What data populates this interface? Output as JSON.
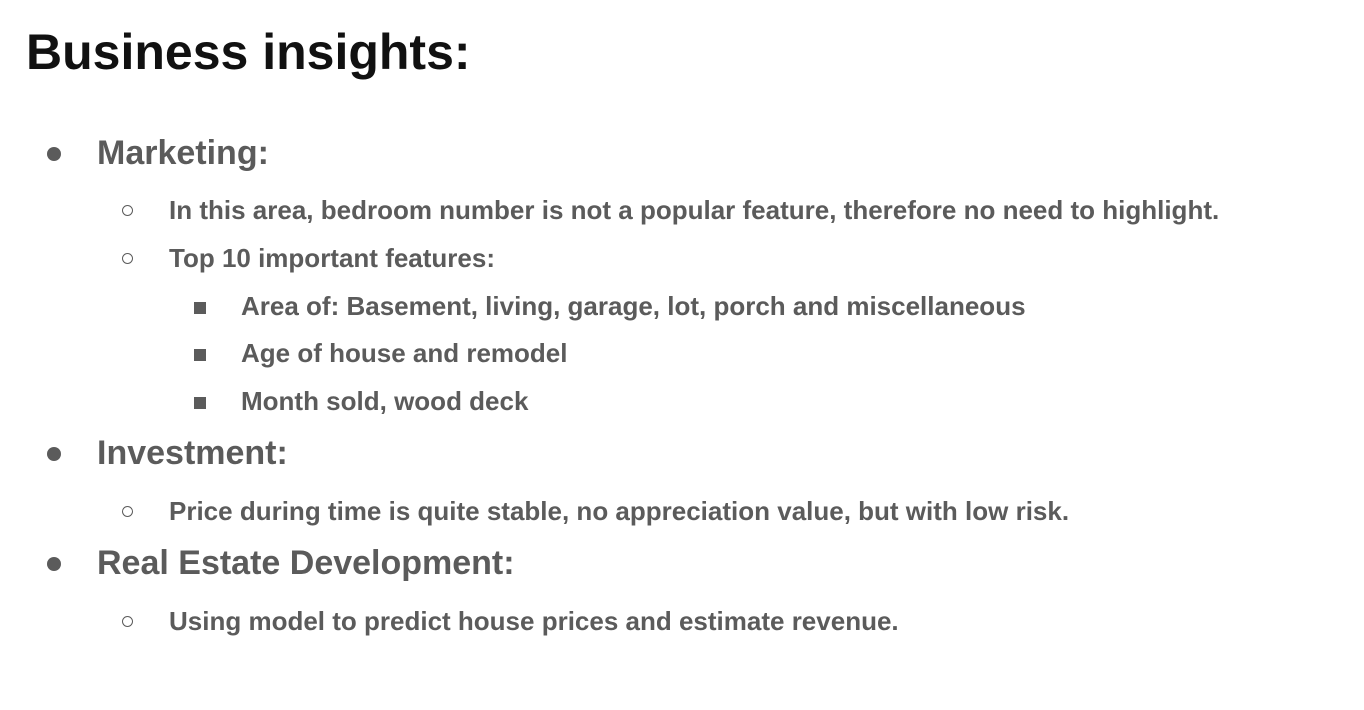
{
  "slide": {
    "title": "Business insights:",
    "sections": [
      {
        "heading": "Marketing:",
        "items": [
          {
            "text": "In this area, bedroom number is not a popular feature, therefore no need to highlight."
          },
          {
            "text": "Top 10 important features:",
            "subitems": [
              "Area of: Basement, living, garage, lot, porch and miscellaneous",
              "Age of house and remodel",
              "Month sold, wood deck"
            ]
          }
        ]
      },
      {
        "heading": "Investment:",
        "items": [
          {
            "text": "Price during time is quite stable, no appreciation value, but with low risk."
          }
        ]
      },
      {
        "heading": "Real Estate Development:",
        "items": [
          {
            "text": "Using model to predict house prices and estimate revenue."
          }
        ]
      }
    ]
  },
  "colors": {
    "title": "#111111",
    "body": "#5b5b5b",
    "background": "#ffffff"
  },
  "icons": {
    "level1": "disc-bullet-icon",
    "level2": "circle-bullet-icon",
    "level3": "square-bullet-icon"
  }
}
